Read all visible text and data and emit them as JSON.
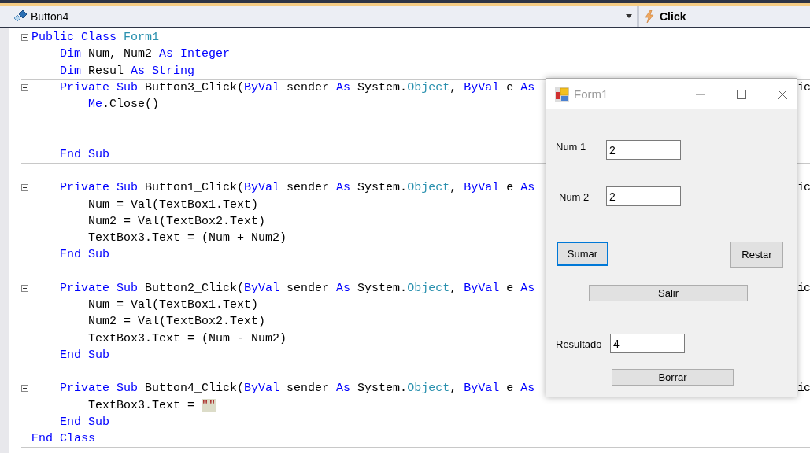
{
  "navigation_bar": {
    "object_dropdown": {
      "value": "Button4"
    },
    "event_dropdown": {
      "value": "Click"
    }
  },
  "code": {
    "lines": [
      {
        "kind": "code",
        "foldable": true,
        "separator_below": false,
        "tokens": [
          {
            "kind": "kw",
            "text": "Public Class "
          },
          {
            "kind": "type",
            "text": "Form1"
          }
        ]
      },
      {
        "kind": "code",
        "foldable": false,
        "separator_below": false,
        "tokens": [
          {
            "kind": "kw",
            "text": "    Dim"
          },
          {
            "kind": "plain",
            "text": " Num, Num2 "
          },
          {
            "kind": "kw",
            "text": "As Integer"
          }
        ]
      },
      {
        "kind": "code",
        "foldable": false,
        "separator_below": true,
        "tokens": [
          {
            "kind": "kw",
            "text": "    Dim"
          },
          {
            "kind": "plain",
            "text": " Resul "
          },
          {
            "kind": "kw",
            "text": "As String"
          }
        ]
      },
      {
        "kind": "code",
        "foldable": true,
        "separator_below": false,
        "tail": "ic",
        "tokens": [
          {
            "kind": "kw",
            "text": "    Private Sub"
          },
          {
            "kind": "plain",
            "text": " Button3_Click("
          },
          {
            "kind": "kw",
            "text": "ByVal"
          },
          {
            "kind": "plain",
            "text": " sender "
          },
          {
            "kind": "kw",
            "text": "As"
          },
          {
            "kind": "plain",
            "text": " System."
          },
          {
            "kind": "type",
            "text": "Object"
          },
          {
            "kind": "plain",
            "text": ", "
          },
          {
            "kind": "kw",
            "text": "ByVal"
          },
          {
            "kind": "plain",
            "text": " e "
          },
          {
            "kind": "kw",
            "text": "As"
          }
        ]
      },
      {
        "kind": "code",
        "foldable": false,
        "separator_below": false,
        "tokens": [
          {
            "kind": "kw",
            "text": "        Me"
          },
          {
            "kind": "plain",
            "text": ".Close()"
          }
        ]
      },
      {
        "kind": "blank"
      },
      {
        "kind": "blank"
      },
      {
        "kind": "code",
        "foldable": false,
        "separator_below": true,
        "tokens": [
          {
            "kind": "kw",
            "text": "    End Sub"
          }
        ]
      },
      {
        "kind": "blank"
      },
      {
        "kind": "code",
        "foldable": true,
        "separator_below": false,
        "tail": "ic",
        "tokens": [
          {
            "kind": "kw",
            "text": "    Private Sub"
          },
          {
            "kind": "plain",
            "text": " Button1_Click("
          },
          {
            "kind": "kw",
            "text": "ByVal"
          },
          {
            "kind": "plain",
            "text": " sender "
          },
          {
            "kind": "kw",
            "text": "As"
          },
          {
            "kind": "plain",
            "text": " System."
          },
          {
            "kind": "type",
            "text": "Object"
          },
          {
            "kind": "plain",
            "text": ", "
          },
          {
            "kind": "kw",
            "text": "ByVal"
          },
          {
            "kind": "plain",
            "text": " e "
          },
          {
            "kind": "kw",
            "text": "As"
          }
        ]
      },
      {
        "kind": "code",
        "foldable": false,
        "separator_below": false,
        "tokens": [
          {
            "kind": "plain",
            "text": "        Num = Val(TextBox1.Text)"
          }
        ]
      },
      {
        "kind": "code",
        "foldable": false,
        "separator_below": false,
        "tokens": [
          {
            "kind": "plain",
            "text": "        Num2 = Val(TextBox2.Text)"
          }
        ]
      },
      {
        "kind": "code",
        "foldable": false,
        "separator_below": false,
        "tokens": [
          {
            "kind": "plain",
            "text": "        TextBox3.Text = (Num + Num2)"
          }
        ]
      },
      {
        "kind": "code",
        "foldable": false,
        "separator_below": true,
        "tokens": [
          {
            "kind": "kw",
            "text": "    End Sub"
          }
        ]
      },
      {
        "kind": "blank"
      },
      {
        "kind": "code",
        "foldable": true,
        "separator_below": false,
        "tail": "ic",
        "tokens": [
          {
            "kind": "kw",
            "text": "    Private Sub"
          },
          {
            "kind": "plain",
            "text": " Button2_Click("
          },
          {
            "kind": "kw",
            "text": "ByVal"
          },
          {
            "kind": "plain",
            "text": " sender "
          },
          {
            "kind": "kw",
            "text": "As"
          },
          {
            "kind": "plain",
            "text": " System."
          },
          {
            "kind": "type",
            "text": "Object"
          },
          {
            "kind": "plain",
            "text": ", "
          },
          {
            "kind": "kw",
            "text": "ByVal"
          },
          {
            "kind": "plain",
            "text": " e "
          },
          {
            "kind": "kw",
            "text": "As"
          }
        ]
      },
      {
        "kind": "code",
        "foldable": false,
        "separator_below": false,
        "tokens": [
          {
            "kind": "plain",
            "text": "        Num = Val(TextBox1.Text)"
          }
        ]
      },
      {
        "kind": "code",
        "foldable": false,
        "separator_below": false,
        "tokens": [
          {
            "kind": "plain",
            "text": "        Num2 = Val(TextBox2.Text)"
          }
        ]
      },
      {
        "kind": "code",
        "foldable": false,
        "separator_below": false,
        "tokens": [
          {
            "kind": "plain",
            "text": "        TextBox3.Text = (Num - Num2)"
          }
        ]
      },
      {
        "kind": "code",
        "foldable": false,
        "separator_below": true,
        "tokens": [
          {
            "kind": "kw",
            "text": "    End Sub"
          }
        ]
      },
      {
        "kind": "blank"
      },
      {
        "kind": "code",
        "foldable": true,
        "separator_below": false,
        "tail": "ic",
        "tokens": [
          {
            "kind": "kw",
            "text": "    Private Sub"
          },
          {
            "kind": "plain",
            "text": " Button4_Click("
          },
          {
            "kind": "kw",
            "text": "ByVal"
          },
          {
            "kind": "plain",
            "text": " sender "
          },
          {
            "kind": "kw",
            "text": "As"
          },
          {
            "kind": "plain",
            "text": " System."
          },
          {
            "kind": "type",
            "text": "Object"
          },
          {
            "kind": "plain",
            "text": ", "
          },
          {
            "kind": "kw",
            "text": "ByVal"
          },
          {
            "kind": "plain",
            "text": " e "
          },
          {
            "kind": "kw",
            "text": "As"
          }
        ]
      },
      {
        "kind": "code",
        "foldable": false,
        "separator_below": false,
        "tokens": [
          {
            "kind": "plain",
            "text": "        TextBox3.Text = "
          },
          {
            "kind": "str",
            "text": "\"\""
          }
        ]
      },
      {
        "kind": "code",
        "foldable": false,
        "separator_below": false,
        "tokens": [
          {
            "kind": "kw",
            "text": "    End Sub"
          }
        ]
      },
      {
        "kind": "code",
        "foldable": false,
        "separator_below": true,
        "tokens": [
          {
            "kind": "kw",
            "text": "End Class"
          }
        ]
      }
    ]
  },
  "form_window": {
    "title": "Form1",
    "controls": [
      {
        "kind": "label",
        "text": "Num 1"
      },
      {
        "kind": "textbox",
        "value": "2"
      },
      {
        "kind": "label",
        "text": "Num 2"
      },
      {
        "kind": "textbox",
        "value": "2"
      },
      {
        "kind": "button",
        "text": "Sumar",
        "focused": true
      },
      {
        "kind": "button",
        "text": "Restar",
        "focused": false
      },
      {
        "kind": "button",
        "text": "Salir",
        "focused": false
      },
      {
        "kind": "label",
        "text": "Resultado"
      },
      {
        "kind": "textbox",
        "value": "4"
      },
      {
        "kind": "button",
        "text": "Borrar",
        "focused": false
      }
    ]
  }
}
